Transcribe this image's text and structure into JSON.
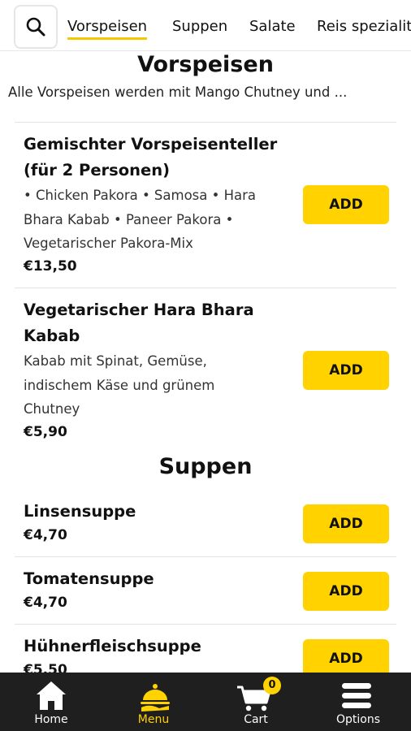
{
  "tabs": [
    {
      "label": "Vorspeisen",
      "active": true
    },
    {
      "label": "Suppen"
    },
    {
      "label": "Salate"
    },
    {
      "label": "Reis spezialitäten"
    }
  ],
  "sections": {
    "vorspeisen": {
      "title": "Vorspeisen",
      "subtitle": "Alle Vorspeisen werden mit Mango Chutney und ...",
      "items": [
        {
          "name_lines": [
            "Gemischter Vorspeisenteller",
            "(für 2 Personen)"
          ],
          "desc_lines": [
            "• Chicken Pakora • Samosa • Hara",
            "Bhara Kabab • Paneer Pakora •",
            "Vegetarischer Pakora-Mix"
          ],
          "price": "€13,50",
          "button": "ADD"
        },
        {
          "name_lines": [
            "Vegetarischer Hara Bhara",
            "Kabab"
          ],
          "desc_lines": [
            "Kabab mit Spinat, Gemüse,",
            "indischem Käse und grünem",
            "Chutney"
          ],
          "price": "€5,90",
          "button": "ADD"
        }
      ]
    },
    "suppen": {
      "title": "Suppen",
      "items": [
        {
          "name": "Linsensuppe",
          "price": "€4,70",
          "button": "ADD"
        },
        {
          "name": "Tomatensuppe",
          "price": "€4,70",
          "button": "ADD"
        },
        {
          "name": "Hühnerfleischsuppe",
          "price": "€5,50",
          "button": "ADD"
        }
      ]
    }
  },
  "bottom_nav": [
    {
      "label": "Home",
      "icon": "home-icon"
    },
    {
      "label": "Menu",
      "icon": "menu-cloche-icon",
      "active": true
    },
    {
      "label": "Cart",
      "icon": "cart-icon",
      "badge": "0"
    },
    {
      "label": "Options",
      "icon": "hamburger-icon"
    }
  ],
  "colors": {
    "accent": "#ffd200",
    "nav_background": "#1f1f1f"
  }
}
